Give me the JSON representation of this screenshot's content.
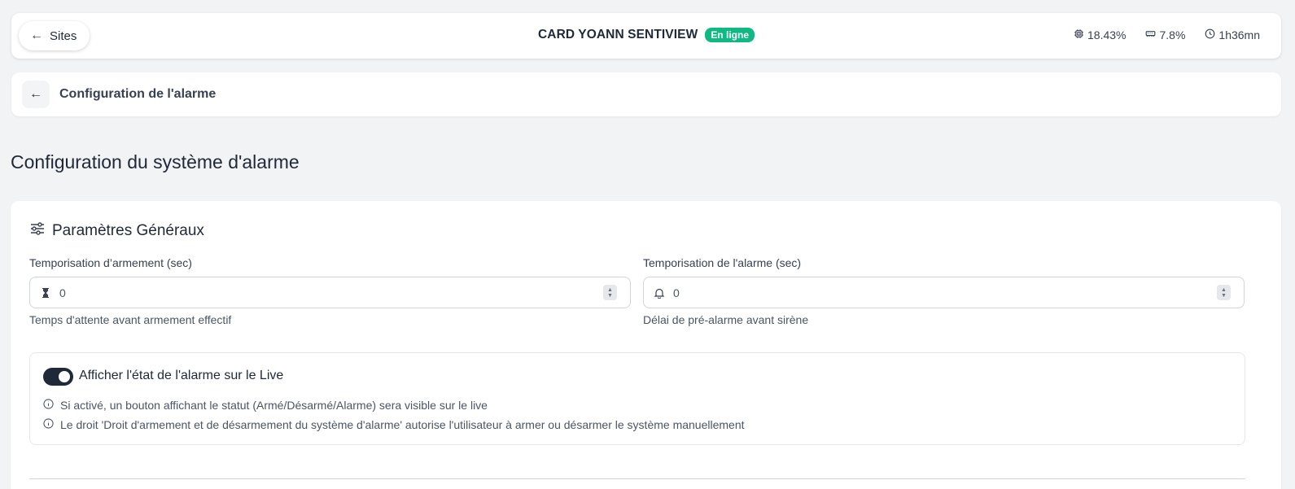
{
  "topbar": {
    "back_label": "Sites",
    "site_name": "CARD YOANN SENTIVIEW",
    "status_badge": "En ligne",
    "stats": {
      "cpu": "18.43%",
      "memory": "7.8%",
      "uptime": "1h36mn"
    }
  },
  "subbar": {
    "title": "Configuration de l'alarme"
  },
  "page": {
    "title": "Configuration du système d'alarme"
  },
  "general": {
    "title": "Paramètres Généraux",
    "arming_delay": {
      "label": "Temporisation d’armement (sec)",
      "value": "0",
      "hint": "Temps d'attente avant armement effectif"
    },
    "alarm_delay": {
      "label": "Temporisation de l'alarme (sec)",
      "value": "0",
      "hint": "Délai de pré-alarme avant sirène"
    },
    "live_toggle": {
      "label": "Afficher l'état de l'alarme sur le Live",
      "enabled": true,
      "info_1": "Si activé, un bouton affichant le statut (Armé/Désarmé/Alarme) sera visible sur le live",
      "info_2": "Le droit 'Droit d'armement et de désarmement du système d'alarme' autorise l'utilisateur à armer ou désarmer le système manuellement"
    }
  },
  "colors": {
    "background": "#f1f3f5",
    "badge_online": "#10b981",
    "toggle_on": "#1f2937"
  },
  "icons": {
    "back": "arrow-left-icon",
    "cpu": "cpu-icon",
    "memory": "memory-icon",
    "uptime": "clock-icon",
    "settings": "sliders-icon",
    "hourglass": "hourglass-icon",
    "bell": "bell-icon",
    "info": "info-icon"
  }
}
